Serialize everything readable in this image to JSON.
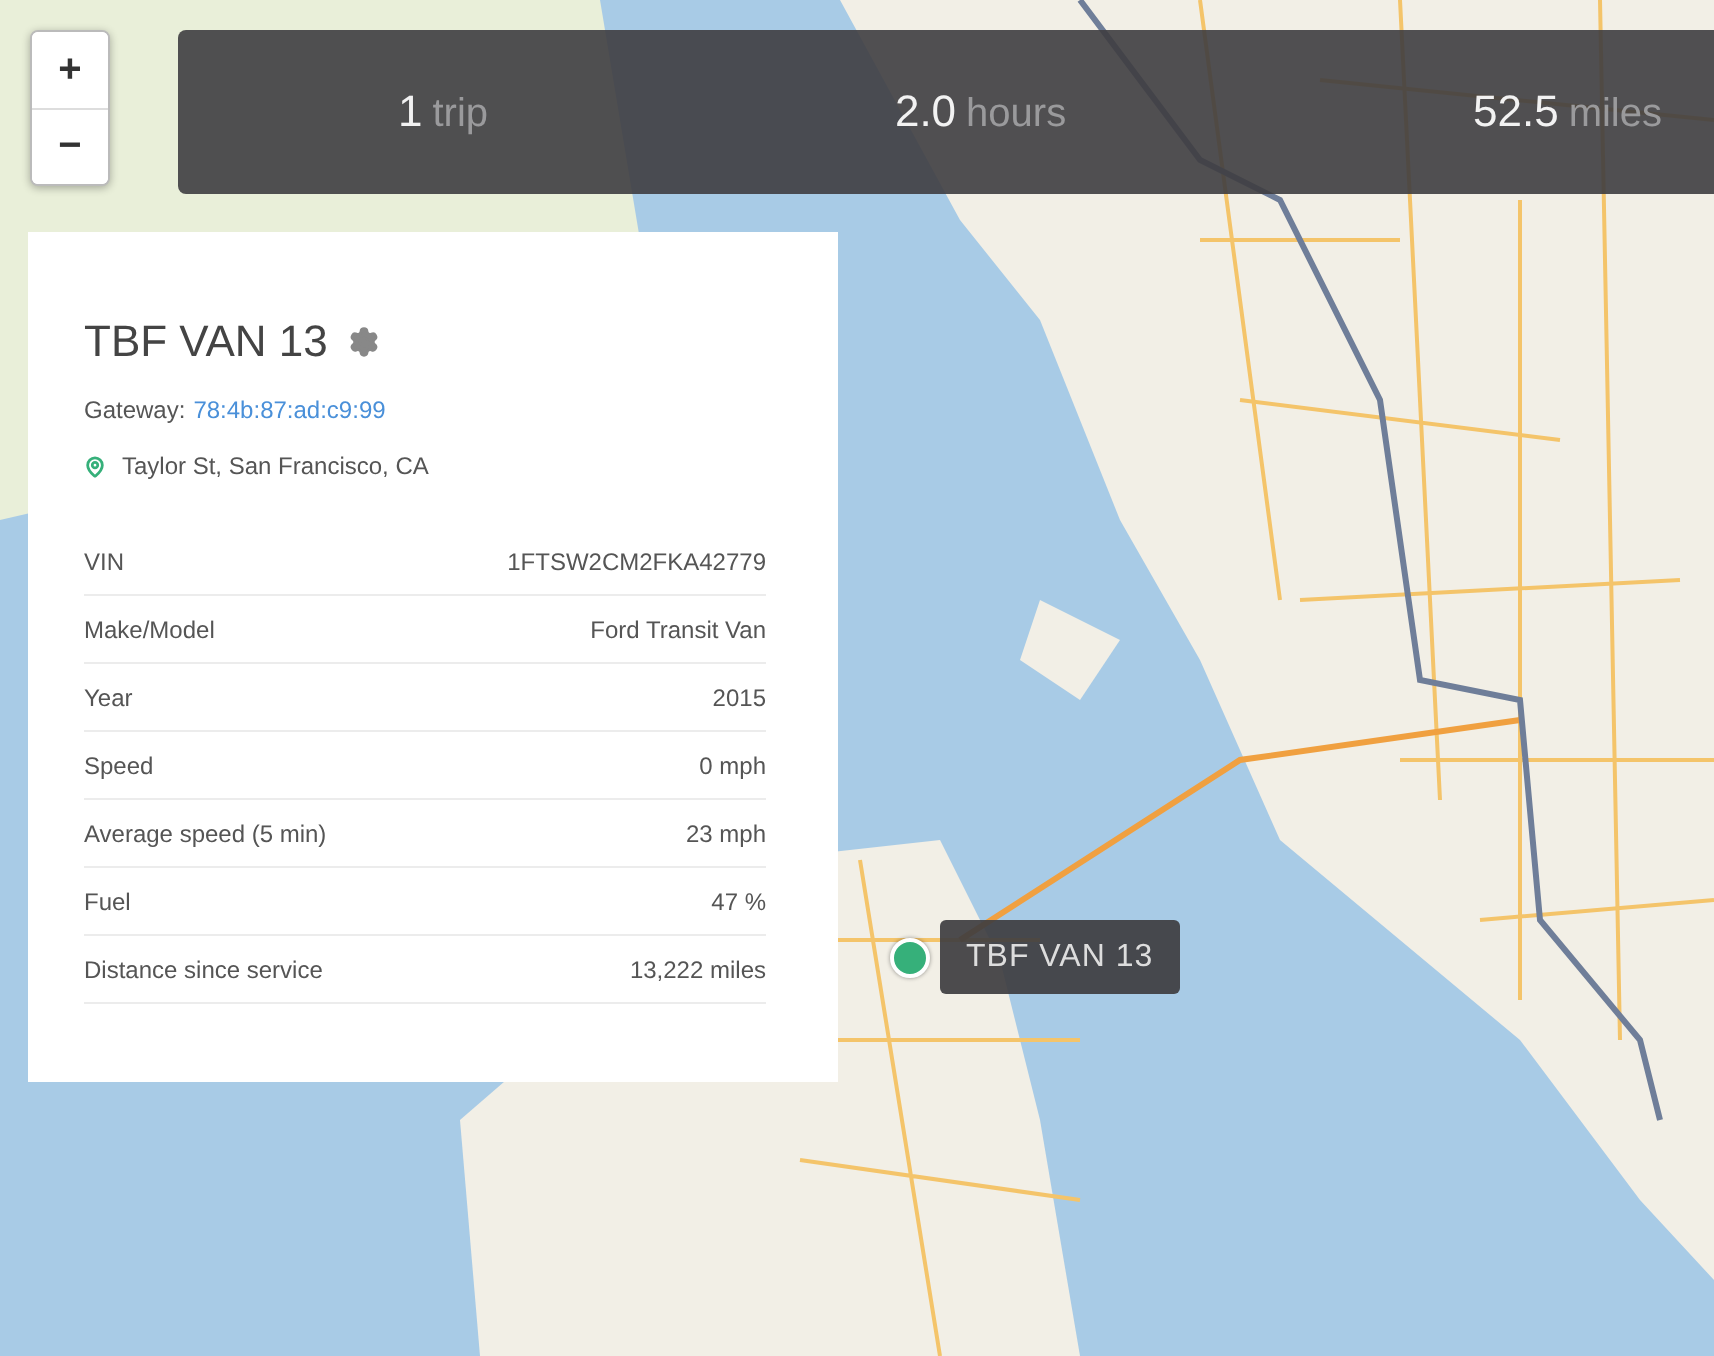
{
  "map_controls": {
    "zoom_in": "+",
    "zoom_out": "−"
  },
  "summary": [
    {
      "value": "1",
      "unit": "trip"
    },
    {
      "value": "2.0",
      "unit": "hours"
    },
    {
      "value": "52.5",
      "unit": "miles"
    }
  ],
  "vehicle": {
    "name": "TBF VAN 13",
    "gateway_label": "Gateway:",
    "gateway": "78:4b:87:ad:c9:99",
    "location": "Taylor St, San Francisco, CA",
    "details": [
      {
        "label": "VIN",
        "value": "1FTSW2CM2FKA42779"
      },
      {
        "label": "Make/Model",
        "value": "Ford Transit Van"
      },
      {
        "label": "Year",
        "value": "2015"
      },
      {
        "label": "Speed",
        "value": "0 mph"
      },
      {
        "label": "Average speed (5 min)",
        "value": "23 mph"
      },
      {
        "label": "Fuel",
        "value": "47 %"
      },
      {
        "label": "Distance since service",
        "value": "13,222 miles"
      }
    ]
  },
  "marker": {
    "label": "TBF VAN 13"
  }
}
